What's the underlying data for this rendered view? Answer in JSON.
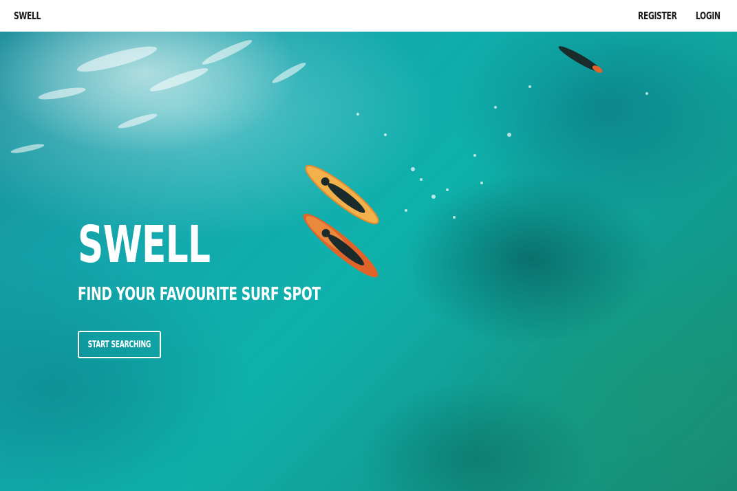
{
  "header": {
    "brand": "SWELL",
    "nav": {
      "register_label": "REGISTER",
      "login_label": "LOGIN"
    }
  },
  "hero": {
    "title": "SWELL",
    "subtitle": "FIND YOUR FAVOURITE SURF SPOT",
    "cta_label": "START SEARCHING",
    "background_image": "aerial-ocean-surfers-photo"
  },
  "colors": {
    "header_bg": "#ffffff",
    "header_text": "#1c1c1c",
    "hero_text": "#ffffff",
    "ocean_teal": "#10b0ab",
    "board_yellow": "#f2b14a",
    "board_orange": "#e0642a"
  }
}
